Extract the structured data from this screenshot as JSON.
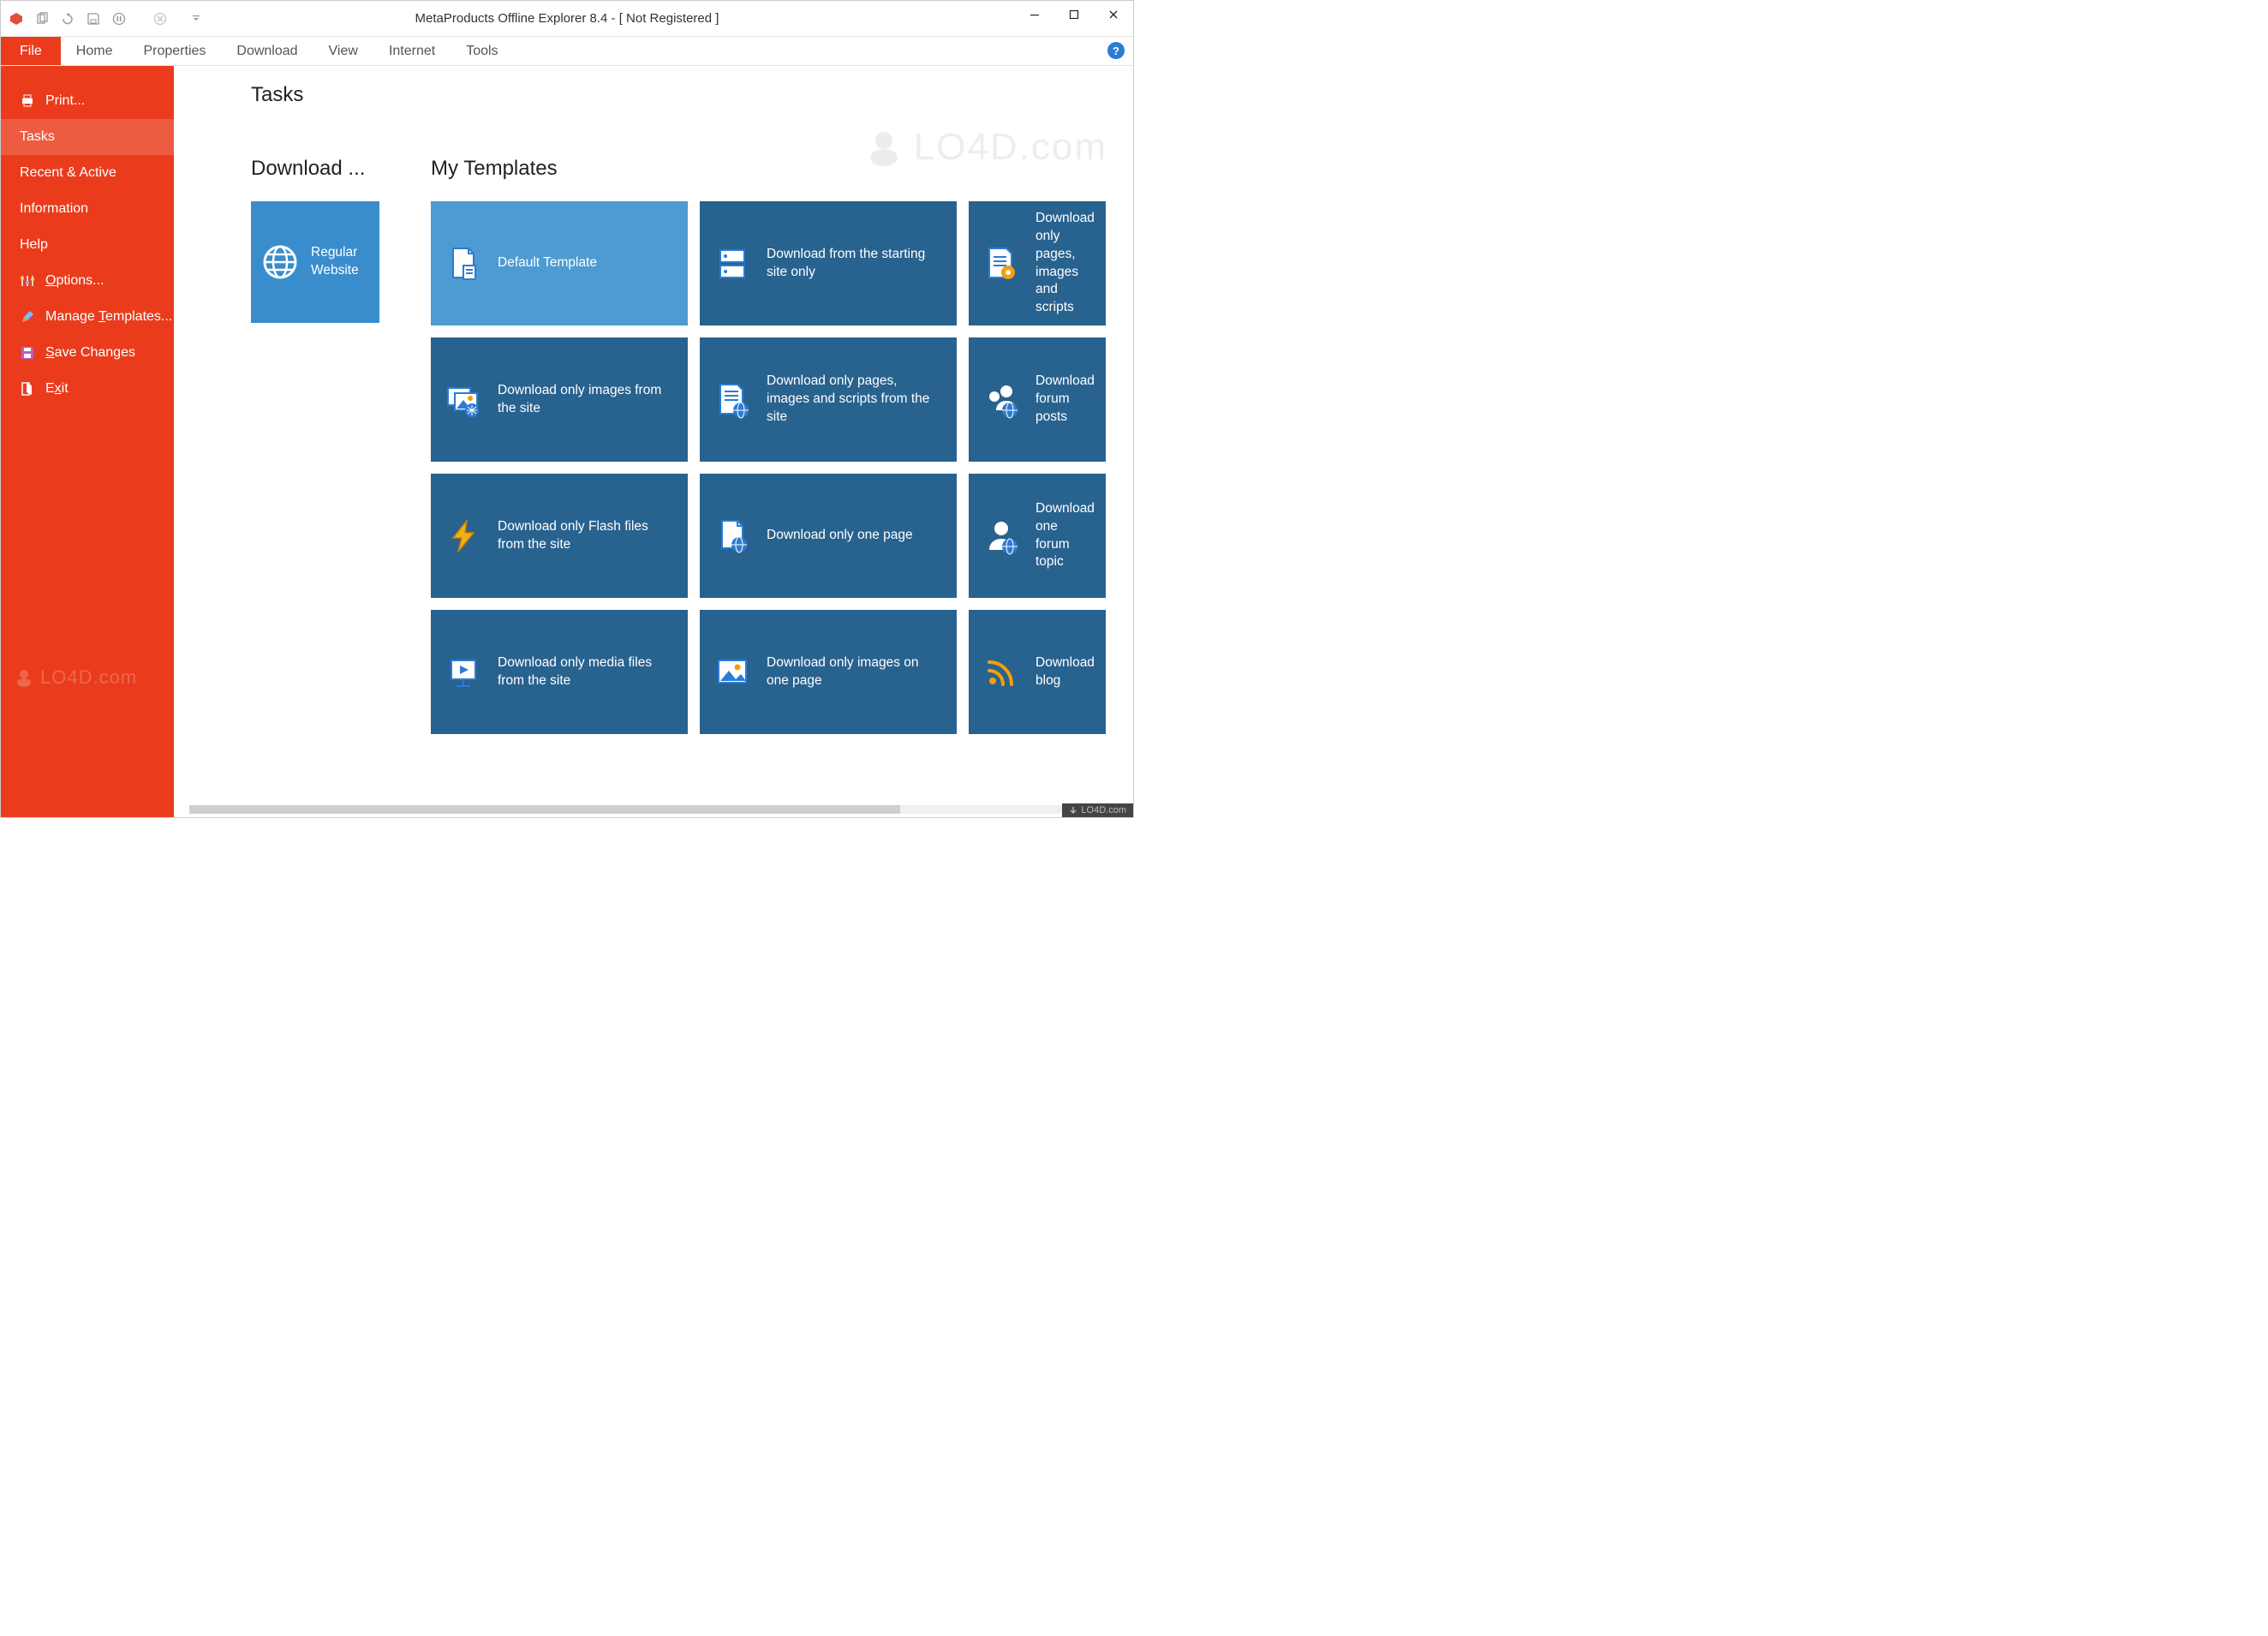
{
  "window": {
    "title": "MetaProducts Offline Explorer 8.4 - [ Not Registered ]"
  },
  "ribbon": {
    "tabs": [
      "File",
      "Home",
      "Properties",
      "Download",
      "View",
      "Internet",
      "Tools"
    ]
  },
  "sidebar": {
    "print": "Print...",
    "tasks": "Tasks",
    "recent": "Recent & Active",
    "information": "Information",
    "help": "Help",
    "options": "Options...",
    "manage": "Manage Templates...",
    "save": "Save Changes",
    "exit": "Exit"
  },
  "page": {
    "title": "Tasks",
    "download_head": "Download ...",
    "templates_head": "My Templates"
  },
  "download_tile": {
    "label": "Regular Website"
  },
  "templates": {
    "r0": [
      {
        "label": "Default Template",
        "light": true,
        "icon": "doc"
      },
      {
        "label": "Download from the starting site only",
        "icon": "server"
      },
      {
        "label": "Download only pages, images and scripts",
        "icon": "doc-gear",
        "cut": true
      }
    ],
    "r1": [
      {
        "label": "Download only images from the site",
        "icon": "pictures"
      },
      {
        "label": "Download only pages, images and scripts from the site",
        "icon": "doc-globe"
      },
      {
        "label": "Download forum posts",
        "icon": "people",
        "cut": true
      }
    ],
    "r2": [
      {
        "label": "Download only Flash files from the site",
        "icon": "flash"
      },
      {
        "label": "Download only one page",
        "icon": "page-globe"
      },
      {
        "label": "Download one forum topic",
        "icon": "person",
        "cut": true
      }
    ],
    "r3": [
      {
        "label": "Download only media files from the site",
        "icon": "media"
      },
      {
        "label": "Download only images on one page",
        "icon": "picture"
      },
      {
        "label": "Download blog",
        "icon": "rss",
        "cut": true
      }
    ]
  },
  "watermark": "LO4D.com",
  "footer": "LO4D.com"
}
